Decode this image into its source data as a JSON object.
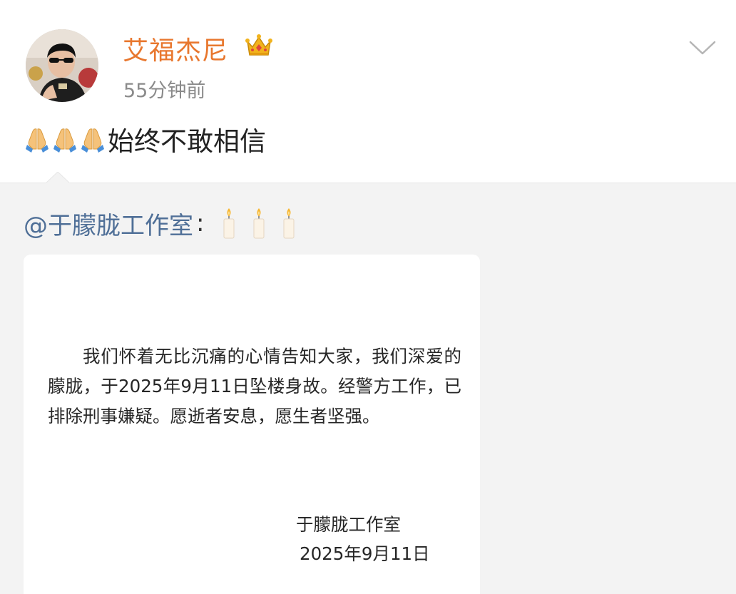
{
  "post": {
    "username": "艾福杰尼",
    "timestamp": "55分钟前",
    "text": "始终不敢相信",
    "emoji_icons": [
      "folded-hands-icon",
      "folded-hands-icon",
      "folded-hands-icon"
    ],
    "username_color": "#e8772e"
  },
  "repost": {
    "mention": "@于朦胧工作室",
    "colon": ":",
    "emoji_icons": [
      "candle-icon",
      "candle-icon",
      "candle-icon"
    ],
    "mention_color": "#4f6f97"
  },
  "notice": {
    "body": "我们怀着无比沉痛的心情告知大家，我们深爱的朦胧，于2025年9月11日坠楼身故。经警方工作，已排除刑事嫌疑。愿逝者安息，愿生者坚强。",
    "signature": "于朦胧工作室",
    "date": "2025年9月11日"
  }
}
